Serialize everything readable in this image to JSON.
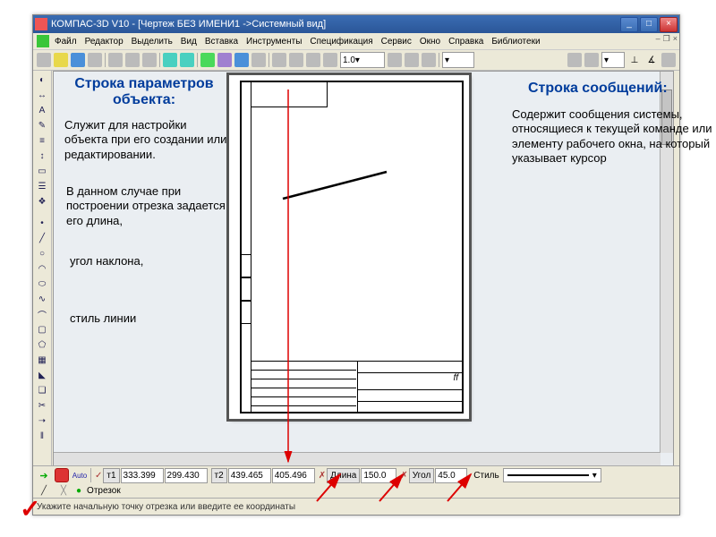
{
  "app": {
    "title": "КОМПАС-3D V10 - [Чертеж БЕЗ ИМЕНИ1 ->Системный вид]"
  },
  "menu": {
    "file": "Файл",
    "edit": "Редактор",
    "select": "Выделить",
    "view": "Вид",
    "insert": "Вставка",
    "tools": "Инструменты",
    "spec": "Спецификация",
    "service": "Сервис",
    "window": "Окно",
    "help": "Справка",
    "lib": "Библиотеки"
  },
  "toolbar2": {
    "zoom": "1.0"
  },
  "param_bar": {
    "auto": "Auto",
    "t1_label": "т1",
    "t1_x": "333.399",
    "t1_y": "299.430",
    "t2_label": "т2",
    "t2_x": "439.465",
    "t2_y": "405.496",
    "len_label": "Длина",
    "len_val": "150.0",
    "ang_label": "Угол",
    "ang_val": "45.0",
    "style_label": "Стиль",
    "tool_name": "Отрезок"
  },
  "statusbar": {
    "msg": "Укажите начальную точку отрезка или введите ее координаты"
  },
  "drawing": {
    "ff": "ff"
  },
  "annotations": {
    "left_title": "Строка параметров объекта:",
    "left_p1": "Служит для настройки объекта при его создании или редактировании.",
    "left_p2": "В данном случае при построении отрезка задается его длина,",
    "left_p3": "угол наклона,",
    "left_p4": "стиль линии",
    "right_title": "Строка сообщений:",
    "right_p1": "Содержит сообщения системы, относящиеся к текущей команде или элементу рабочего окна, на который  указывает курсор"
  }
}
